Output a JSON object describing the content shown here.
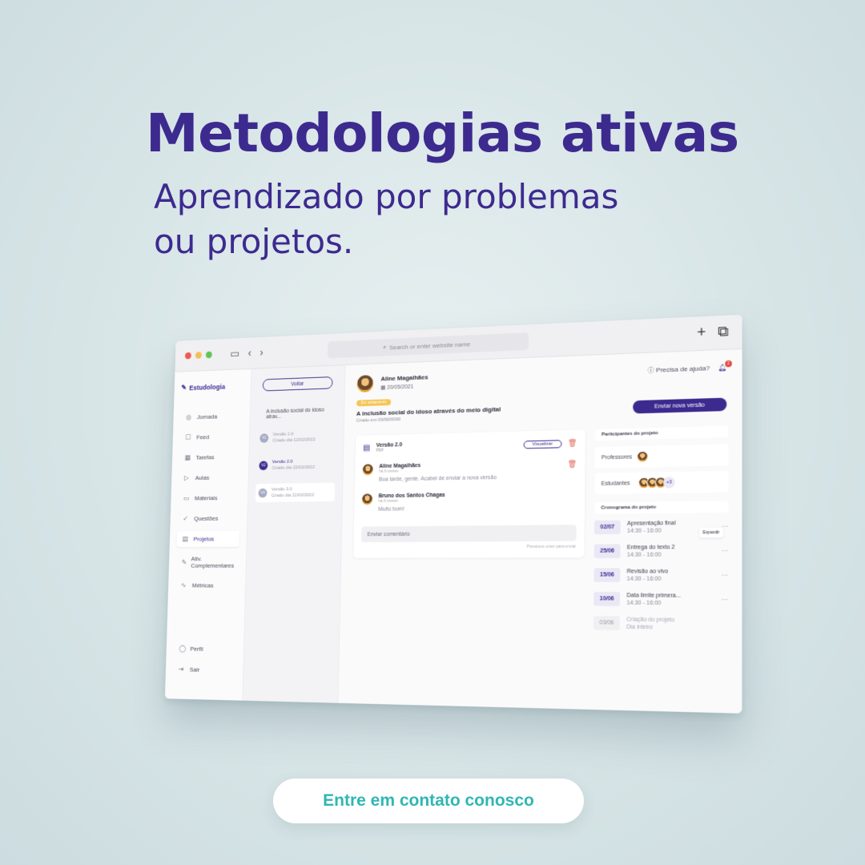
{
  "hero": {
    "title": "Metodologias ativas",
    "subtitle_line1": "Aprendizado por problemas",
    "subtitle_line2": "ou projetos.",
    "cta_label": "Entre em contato conosco"
  },
  "browser": {
    "url_placeholder": "Search or enter website name"
  },
  "sidebar": {
    "brand": "Estudologia",
    "items": [
      {
        "label": "Jornada",
        "icon": "compass-icon"
      },
      {
        "label": "Feed",
        "icon": "feed-icon"
      },
      {
        "label": "Tarefas",
        "icon": "calendar-icon"
      },
      {
        "label": "Aulas",
        "icon": "video-icon"
      },
      {
        "label": "Materiais",
        "icon": "folder-icon"
      },
      {
        "label": "Questões",
        "icon": "check-circle-icon"
      },
      {
        "label": "Projetos",
        "icon": "clipboard-icon"
      },
      {
        "label": "Ativ. Complementares",
        "icon": "pencil-icon"
      },
      {
        "label": "Métricas",
        "icon": "pulse-icon"
      }
    ],
    "active": "Projetos",
    "bottom": [
      {
        "label": "Perfil",
        "icon": "user-icon"
      },
      {
        "label": "Sair",
        "icon": "logout-icon"
      }
    ]
  },
  "versions": {
    "back_label": "Voltar",
    "project_title": "A inclusão social do idoso atrav...",
    "items": [
      {
        "badge": "V1",
        "name": "Versão 1.0",
        "created": "Criado dia 12/02/2022"
      },
      {
        "badge": "V2",
        "name": "Versão 2.0",
        "created": "Criado dia 22/02/2022"
      },
      {
        "badge": "V3",
        "name": "Versão 3.0",
        "created": "Criado dia 22/02/2022"
      }
    ]
  },
  "header": {
    "author": "Aline Magalhães",
    "date": "20/05/2021",
    "help_label": "Precisa de ajuda?",
    "notifications": "2",
    "status_tag": "Em andamento",
    "project_title": "A inclusão social do idoso através do meio digital",
    "created": "Criado em 00/00/0000",
    "send_button": "Enviar nova versão"
  },
  "file": {
    "name": "Versão 2.0",
    "type": "PDF",
    "view_button": "Visualizar"
  },
  "comments": [
    {
      "name": "Aline Magalhães",
      "time": "há 6 meses",
      "text": "Boa tarde, gente. Acabei de enviar a nova versão"
    },
    {
      "name": "Bruno dos Santos Chagas",
      "time": "há 6 meses",
      "text": "Muito bom!"
    }
  ],
  "comment_input": {
    "placeholder": "Enviar comentário",
    "hint": "Pressione enter para enviar"
  },
  "participants": {
    "title": "Participantes do projeto",
    "teachers_label": "Professores",
    "students_label": "Estudantes",
    "students_more": "+3"
  },
  "schedule": {
    "title": "Cronograma do projeto",
    "expand_label": "Expandir",
    "items": [
      {
        "date": "02/07",
        "title": "Apresentação final",
        "time": "14:30 - 16:00"
      },
      {
        "date": "25/06",
        "title": "Entrega do texto 2",
        "time": "14:30 - 16:00"
      },
      {
        "date": "15/06",
        "title": "Revisão ao vivo",
        "time": "14:30 - 16:00"
      },
      {
        "date": "10/06",
        "title": "Data limite primera...",
        "time": "14:30 - 16:00"
      },
      {
        "date": "03/06",
        "title": "Criação do projeto",
        "time": "Dia inteiro"
      }
    ]
  },
  "colors": {
    "brand": "#3d2a8f",
    "cta_text": "#2fb7b2",
    "status_tag": "#f4c554"
  }
}
